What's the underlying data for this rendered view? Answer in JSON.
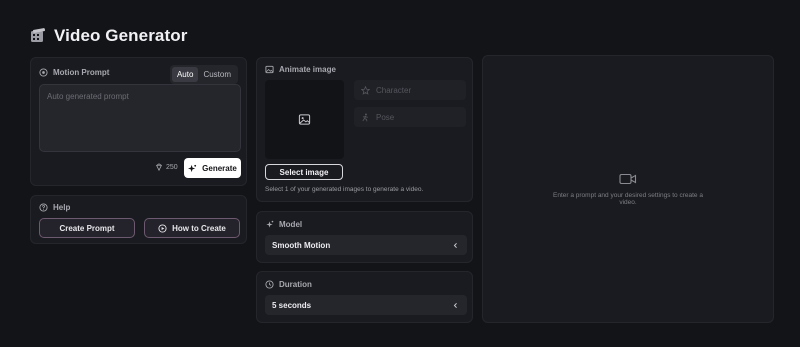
{
  "header": {
    "title": "Video Generator"
  },
  "motion_prompt": {
    "label": "Motion Prompt",
    "modes": [
      "Auto",
      "Custom"
    ],
    "active_mode": "Auto",
    "prompt_placeholder": "Auto generated prompt",
    "credits": "250",
    "generate_label": "Generate"
  },
  "help": {
    "label": "Help",
    "create_prompt_label": "Create Prompt",
    "how_to_label": "How to Create"
  },
  "animate": {
    "label": "Animate image",
    "character_label": "Character",
    "pose_label": "Pose",
    "select_label": "Select image",
    "hint": "Select 1 of your generated images to generate a video."
  },
  "model": {
    "label": "Model",
    "value": "Smooth Motion"
  },
  "duration": {
    "label": "Duration",
    "value": "5 seconds"
  },
  "preview": {
    "empty_text": "Enter a prompt and your desired settings to create a video."
  },
  "colors": {
    "background": "#131418",
    "panel": "#1a1b20",
    "accent_border": "#6d5a70"
  }
}
